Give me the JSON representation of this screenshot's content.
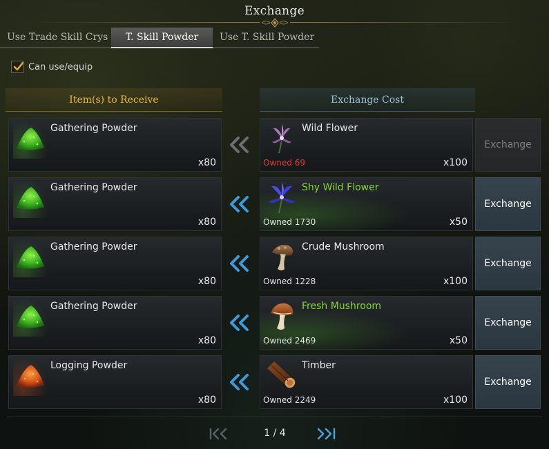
{
  "window": {
    "title": "Exchange"
  },
  "tabs": [
    {
      "label": "Use Trade Skill Crys",
      "active": false
    },
    {
      "label": "T. Skill Powder",
      "active": true
    },
    {
      "label": "Use T. Skill Powder",
      "active": false
    }
  ],
  "filter": {
    "label": "Can use/equip",
    "checked": true
  },
  "headers": {
    "receive": "Item(s) to Receive",
    "cost": "Exchange Cost"
  },
  "rows": [
    {
      "receive": {
        "name": "Gathering Powder",
        "qty": "x80",
        "icon": "gathering-powder-icon"
      },
      "cost": {
        "name": "Wild Flower",
        "name_color": "#e8e8e8",
        "owned_label": "Owned",
        "owned_value": "69",
        "owned_insufficient": true,
        "qty": "x100",
        "icon": "wild-flower-icon"
      },
      "button": {
        "label": "Exchange",
        "enabled": false
      }
    },
    {
      "receive": {
        "name": "Gathering Powder",
        "qty": "x80",
        "icon": "gathering-powder-icon"
      },
      "cost": {
        "name": "Shy Wild Flower",
        "name_color": "#86d43a",
        "owned_label": "Owned",
        "owned_value": "1730",
        "owned_insufficient": false,
        "qty": "x50",
        "icon": "shy-wild-flower-icon"
      },
      "button": {
        "label": "Exchange",
        "enabled": true
      }
    },
    {
      "receive": {
        "name": "Gathering Powder",
        "qty": "x80",
        "icon": "gathering-powder-icon"
      },
      "cost": {
        "name": "Crude Mushroom",
        "name_color": "#e8e8e8",
        "owned_label": "Owned",
        "owned_value": "1228",
        "owned_insufficient": false,
        "qty": "x100",
        "icon": "crude-mushroom-icon"
      },
      "button": {
        "label": "Exchange",
        "enabled": true
      }
    },
    {
      "receive": {
        "name": "Gathering Powder",
        "qty": "x80",
        "icon": "gathering-powder-icon"
      },
      "cost": {
        "name": "Fresh Mushroom",
        "name_color": "#86d43a",
        "owned_label": "Owned",
        "owned_value": "2469",
        "owned_insufficient": false,
        "qty": "x50",
        "icon": "fresh-mushroom-icon"
      },
      "button": {
        "label": "Exchange",
        "enabled": true
      }
    },
    {
      "receive": {
        "name": "Logging Powder",
        "qty": "x80",
        "icon": "logging-powder-icon"
      },
      "cost": {
        "name": "Timber",
        "name_color": "#e8e8e8",
        "owned_label": "Owned",
        "owned_value": "2249",
        "owned_insufficient": false,
        "qty": "x100",
        "icon": "timber-icon"
      },
      "button": {
        "label": "Exchange",
        "enabled": true
      }
    }
  ],
  "pagination": {
    "current": 1,
    "total": 4,
    "text": "1 / 4"
  },
  "colors": {
    "receive_header": "#e7b840",
    "cost_header": "#9cc0d4",
    "rare_name": "#86d43a",
    "insufficient": "#e33b35",
    "arrow_enabled": "#3f9ad8",
    "arrow_disabled": "#6a7075"
  }
}
